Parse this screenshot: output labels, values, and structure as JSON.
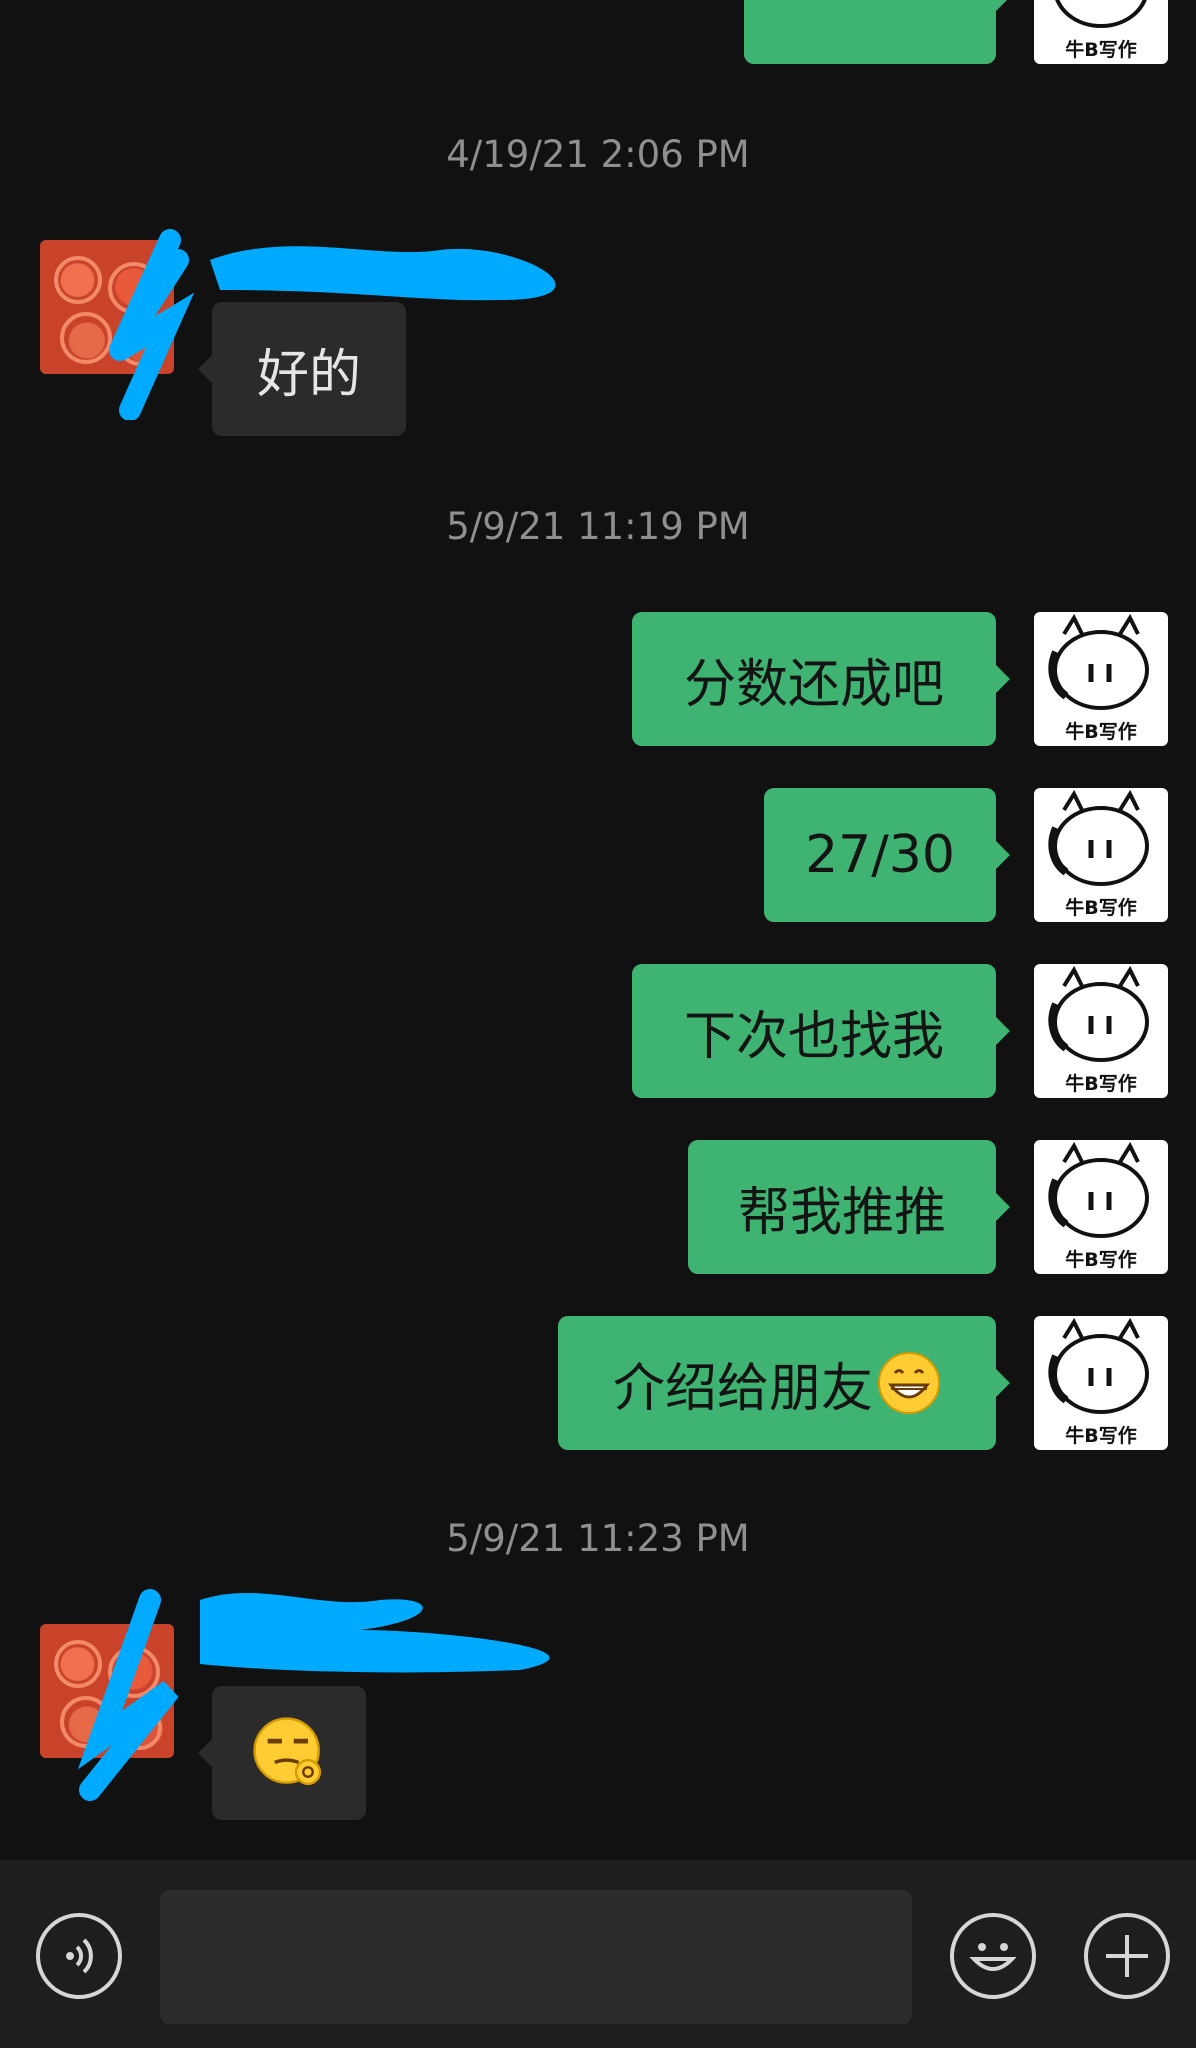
{
  "chat": {
    "partial_top_message": {
      "sender": "me",
      "text": ""
    },
    "groups": [
      {
        "timestamp": "4/19/21 2:06 PM",
        "messages": [
          {
            "sender": "contact",
            "text": "好的"
          }
        ]
      },
      {
        "timestamp": "5/9/21 11:19 PM",
        "messages": [
          {
            "sender": "me",
            "text": "分数还成吧"
          },
          {
            "sender": "me",
            "text": "27/30"
          },
          {
            "sender": "me",
            "text": "下次也找我"
          },
          {
            "sender": "me",
            "text": "帮我推推"
          },
          {
            "sender": "me",
            "text": "介绍给朋友",
            "emoji": "grinning-face-emoji"
          }
        ]
      },
      {
        "timestamp": "5/9/21 11:23 PM",
        "messages": [
          {
            "sender": "contact",
            "emoji": "smirk-ok-hand-emoji"
          }
        ]
      }
    ],
    "my_avatar": {
      "label": "牛B写作",
      "icon": "cow-face-avatar"
    },
    "contact_avatar": {
      "icon": "red-roses-avatar"
    },
    "contact_name": {
      "redacted": true,
      "redaction_color": "#00aaff"
    }
  },
  "input_bar": {
    "voice_icon": "voice-icon",
    "text_value": "",
    "emoji_icon": "smiley-icon",
    "more_icon": "plus-icon"
  },
  "colors": {
    "background": "#111111",
    "my_bubble": "#3fb472",
    "contact_bubble": "#2b2b2b",
    "timestamp_text": "#8f8f8f",
    "input_bar": "#1e1e1e"
  }
}
